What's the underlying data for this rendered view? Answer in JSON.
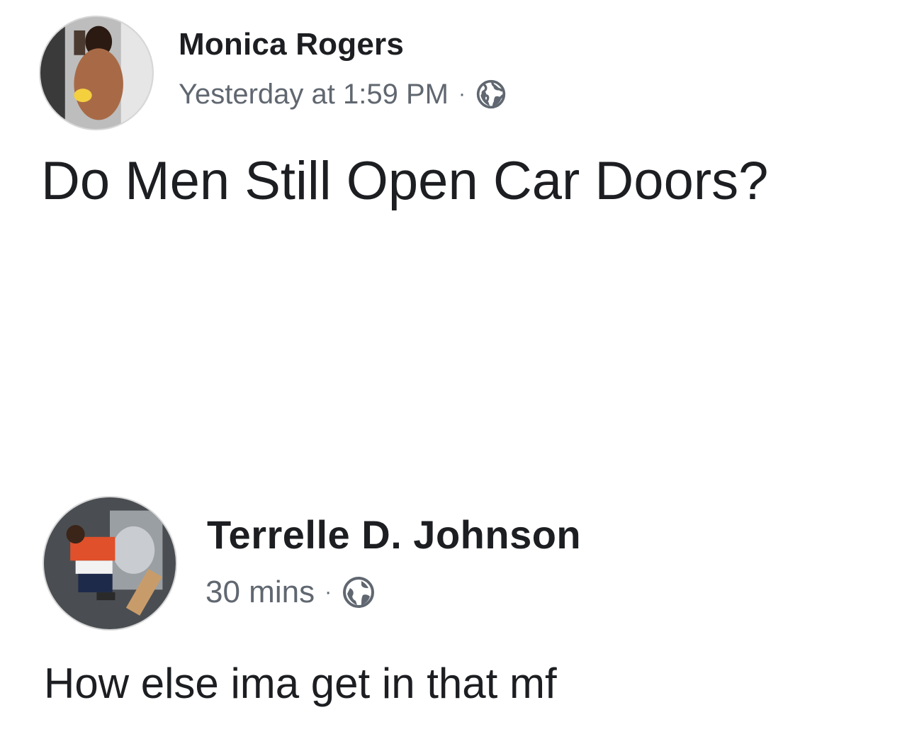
{
  "post": {
    "author": "Monica Rogers",
    "timestamp": "Yesterday at 1:59 PM",
    "separator": "·",
    "privacy_icon": "globe-icon",
    "text": "Do Men Still Open Car Doors?"
  },
  "comment": {
    "author": "Terrelle D. Johnson",
    "timestamp": "30 mins",
    "separator": "·",
    "privacy_icon": "globe-icon",
    "text": "How else ima get in that mf"
  },
  "colors": {
    "name_text": "#1c1e21",
    "meta_text": "#606770",
    "background": "#ffffff"
  }
}
